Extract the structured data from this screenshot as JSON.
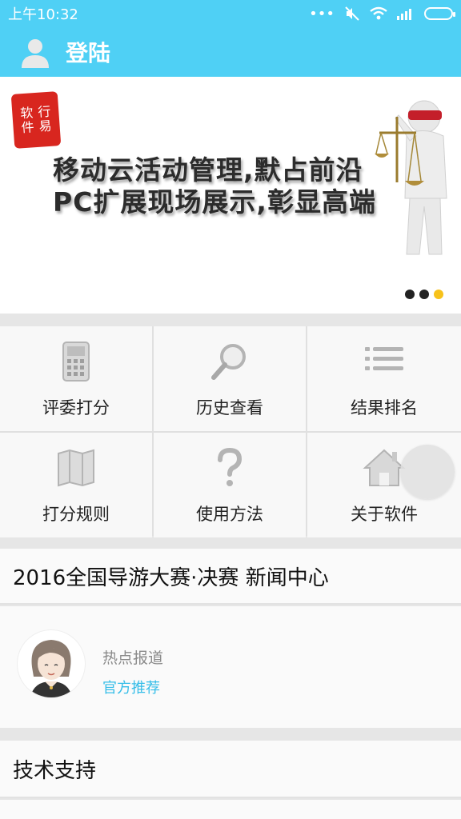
{
  "status": {
    "time": "上午10:32",
    "dots": "•••"
  },
  "appbar": {
    "title": "登陆"
  },
  "banner": {
    "seal_text": [
      "软",
      "件",
      "行",
      "易"
    ],
    "line1": "移动云活动管理,默占前沿",
    "line2": "PC扩展现场展示,彰显高端",
    "page_count": 3,
    "active_page": 3
  },
  "menu": [
    {
      "label": "评委打分",
      "icon": "calculator-icon"
    },
    {
      "label": "历史查看",
      "icon": "magnifier-icon"
    },
    {
      "label": "结果排名",
      "icon": "list-icon"
    },
    {
      "label": "打分规则",
      "icon": "map-icon"
    },
    {
      "label": "使用方法",
      "icon": "question-icon"
    },
    {
      "label": "关于软件",
      "icon": "home-icon"
    }
  ],
  "news": {
    "title": "2016全国导游大赛·决赛 新闻中心",
    "item": {
      "heading": "热点报道",
      "tag": "官方推荐"
    }
  },
  "support": {
    "title": "技术支持"
  },
  "colors": {
    "primary": "#4fd0f5",
    "active_dot": "#f7c21a",
    "link": "#35bde8"
  }
}
